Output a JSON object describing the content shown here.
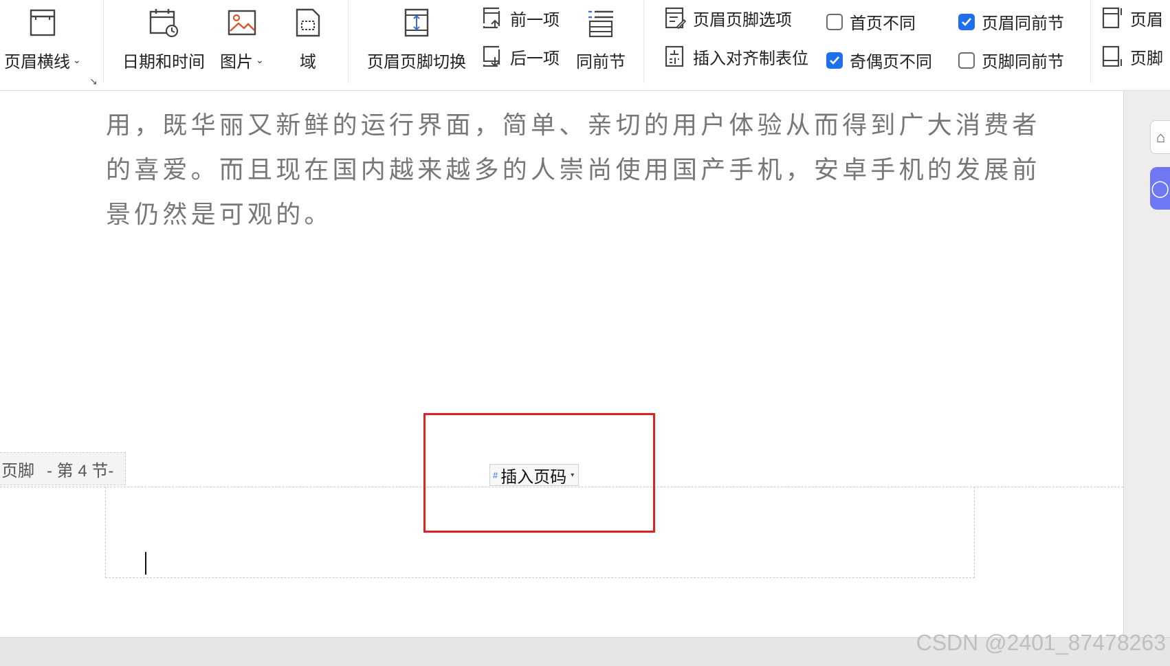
{
  "ribbon": {
    "header_line": "页眉横线",
    "date_time": "日期和时间",
    "picture": "图片",
    "field": "域",
    "switch_header_footer": "页眉页脚切换",
    "prev_item": "前一项",
    "next_item": "后一项",
    "same_as_previous": "同前节",
    "header_footer_options": "页眉页脚选项",
    "insert_align_tab": "插入对齐制表位",
    "first_page_diff": "首页不同",
    "odd_even_diff": "奇偶页不同",
    "header_same_prev": "页眉同前节",
    "footer_same_prev": "页脚同前节",
    "header_top": "页眉",
    "footer_bottom": "页脚",
    "checks": {
      "first_page_diff": false,
      "odd_even_diff": true,
      "header_same_prev": true,
      "footer_same_prev": false
    }
  },
  "document": {
    "lines": [
      "用，既华丽又新鲜的运行界面，简单、亲切的用户体验从而得到广大消费者",
      "的喜爱。而且现在国内越来越多的人崇尚使用国产手机，安卓手机的发展前",
      "景仍然是可观的。"
    ]
  },
  "footer": {
    "label": "页脚",
    "section": "- 第 4 节-",
    "insert_page_number": "插入页码"
  },
  "watermark": "CSDN @2401_87478263",
  "colors": {
    "checkbox_on": "#1f6feb",
    "highlight_box": "#e02020",
    "rail_button": "#6f78f2"
  }
}
